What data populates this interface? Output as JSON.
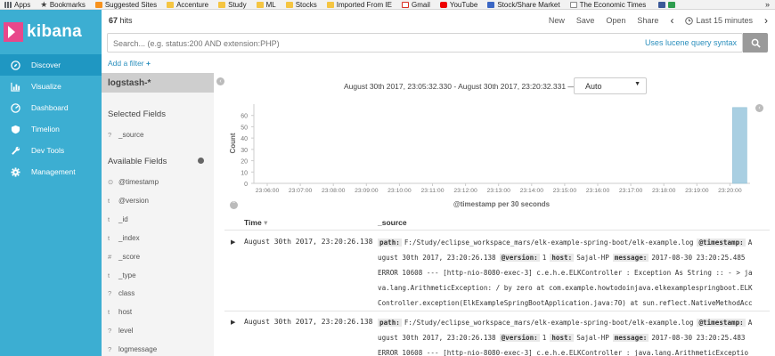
{
  "bookmarks": {
    "items": [
      {
        "label": "Apps",
        "icon": "apps-grid-icon"
      },
      {
        "label": "Bookmarks",
        "icon": "star-icon"
      },
      {
        "label": "Suggested Sites",
        "icon": "suggested-sites-icon"
      },
      {
        "label": "Accenture",
        "icon": "folder-icon"
      },
      {
        "label": "Study",
        "icon": "folder-icon"
      },
      {
        "label": "ML",
        "icon": "folder-icon"
      },
      {
        "label": "Stocks",
        "icon": "folder-icon"
      },
      {
        "label": "Imported From IE",
        "icon": "folder-icon"
      },
      {
        "label": "Gmail",
        "icon": "gmail-icon"
      },
      {
        "label": "YouTube",
        "icon": "youtube-icon"
      },
      {
        "label": "Stock/Share Market",
        "icon": "site-icon"
      },
      {
        "label": "The Economic Times",
        "icon": "et-icon"
      }
    ],
    "more": "»"
  },
  "app": {
    "name": "kibana"
  },
  "nav": [
    {
      "label": "Discover",
      "icon": "compass-icon",
      "active": true
    },
    {
      "label": "Visualize",
      "icon": "bar-chart-icon"
    },
    {
      "label": "Dashboard",
      "icon": "dashboard-icon"
    },
    {
      "label": "Timelion",
      "icon": "shield-icon"
    },
    {
      "label": "Dev Tools",
      "icon": "wrench-icon"
    },
    {
      "label": "Management",
      "icon": "gear-icon"
    }
  ],
  "toolbar": {
    "hits_count": "67",
    "hits_label": " hits",
    "new_label": "New",
    "save_label": "Save",
    "open_label": "Open",
    "share_label": "Share",
    "prev": "‹",
    "time_label": "Last 15 minutes",
    "next": "›"
  },
  "search": {
    "placeholder": "Search... (e.g. status:200 AND extension:PHP)",
    "lucene_link": "Uses lucene query syntax"
  },
  "filter": {
    "add_label": "Add a filter",
    "plus": "+"
  },
  "sidebar_fields": {
    "index_pattern": "logstash-*",
    "selected_title": "Selected Fields",
    "selected": [
      {
        "type": "?",
        "name": "_source"
      }
    ],
    "available_title": "Available Fields",
    "available": [
      {
        "type": "⊙",
        "name": "@timestamp"
      },
      {
        "type": "t",
        "name": "@version"
      },
      {
        "type": "t",
        "name": "_id"
      },
      {
        "type": "t",
        "name": "_index"
      },
      {
        "type": "#",
        "name": "_score"
      },
      {
        "type": "t",
        "name": "_type"
      },
      {
        "type": "?",
        "name": "class"
      },
      {
        "type": "t",
        "name": "host"
      },
      {
        "type": "?",
        "name": "level"
      },
      {
        "type": "?",
        "name": "logmessage"
      }
    ]
  },
  "histogram": {
    "range_label": "August 30th 2017, 23:05:32.330 - August 30th 2017, 23:20:32.331 —",
    "interval": "Auto"
  },
  "chart_data": {
    "type": "bar",
    "title": "",
    "xlabel": "@timestamp per 30 seconds",
    "ylabel": "Count",
    "ylim": [
      0,
      70
    ],
    "yticks": [
      0,
      10,
      20,
      30,
      40,
      50,
      60
    ],
    "xticks": [
      "23:06:00",
      "23:07:00",
      "23:08:00",
      "23:09:00",
      "23:10:00",
      "23:11:00",
      "23:12:00",
      "23:13:00",
      "23:14:00",
      "23:15:00",
      "23:16:00",
      "23:17:00",
      "23:18:00",
      "23:19:00",
      "23:20:00"
    ],
    "bars": [
      {
        "x": "23:20:00",
        "value": 67
      }
    ],
    "bar_color": "#a9cfe2",
    "grid": false
  },
  "table": {
    "columns": [
      "Time",
      "_source"
    ],
    "sort_icon": "▾",
    "rows": [
      {
        "time": "August 30th 2017, 23:20:26.138",
        "lines": [
          [
            {
              "k": "path:"
            },
            {
              "v": "F:/Study/eclipse_workspace_mars/elk-example-spring-boot/elk-example.log"
            },
            {
              "k": "@timestamp:"
            },
            {
              "v": "A"
            }
          ],
          [
            {
              "v": "ugust 30th 2017, 23:20:26.138"
            },
            {
              "k": "@version:"
            },
            {
              "v": "1"
            },
            {
              "k": "host:"
            },
            {
              "v": "Sajal-HP"
            },
            {
              "k": "message:"
            },
            {
              "v": "2017-08-30 23:20:25.485"
            }
          ],
          [
            {
              "v": "ERROR 10608 --- [http-nio-8080-exec-3] c.e.h.e.ELKController : Exception As String :: - > ja"
            }
          ],
          [
            {
              "v": "va.lang.ArithmeticException: / by zero at com.example.howtodoinjava.elkexamplespringboot.ELK"
            }
          ],
          [
            {
              "v": "Controller.exception(ElkExampleSpringBootApplication.java:70) at sun.reflect.NativeMethodAcc"
            }
          ]
        ]
      },
      {
        "time": "August 30th 2017, 23:20:26.138",
        "lines": [
          [
            {
              "k": "path:"
            },
            {
              "v": "F:/Study/eclipse_workspace_mars/elk-example-spring-boot/elk-example.log"
            },
            {
              "k": "@timestamp:"
            },
            {
              "v": "A"
            }
          ],
          [
            {
              "v": "ugust 30th 2017, 23:20:26.138"
            },
            {
              "k": "@version:"
            },
            {
              "v": "1"
            },
            {
              "k": "host:"
            },
            {
              "v": "Sajal-HP"
            },
            {
              "k": "message:"
            },
            {
              "v": "2017-08-30 23:20:25.483"
            }
          ],
          [
            {
              "v": "ERROR 10608 --- [http-nio-8080-exec-3] c.e.h.e.ELKController : java.lang.ArithmeticExceptio"
            }
          ]
        ]
      }
    ]
  },
  "colors": {
    "nav_bg": "#3caed2",
    "nav_active": "#1f97c2",
    "logo": "#e8488b",
    "link": "#2b8fbd"
  }
}
